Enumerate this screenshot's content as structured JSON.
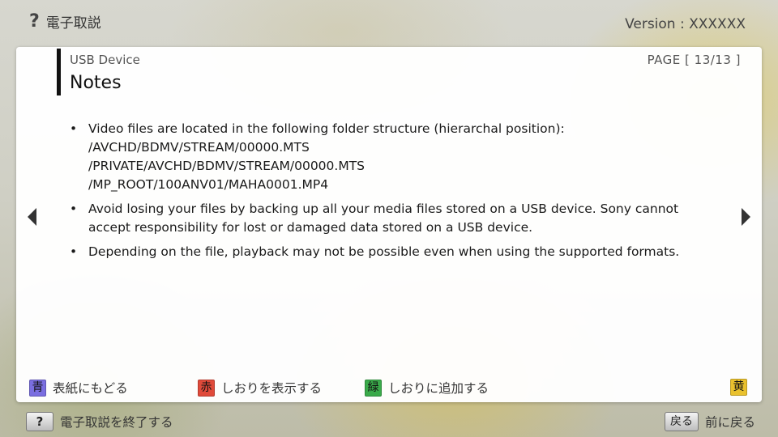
{
  "top": {
    "help_mark": "?",
    "title": "電子取説",
    "version": "Version : XXXXXX"
  },
  "panel": {
    "category": "USB Device",
    "page": "PAGE [ 13/13 ]",
    "heading": "Notes",
    "bullet": "•",
    "items": [
      {
        "lines": [
          "Video files are located in the following folder structure (hierarchal position):",
          "/AVCHD/BDMV/STREAM/00000.MTS",
          "/PRIVATE/AVCHD/BDMV/STREAM/00000.MTS",
          "/MP_ROOT/100ANV01/MAHA0001.MP4"
        ]
      },
      {
        "lines": [
          "Avoid losing your files by backing up all your media files stored on a USB device. Sony cannot",
          "accept responsibility for lost or damaged data stored on a USB device."
        ]
      },
      {
        "lines": [
          "Depending on the file, playback may not be possible even when using the supported formats."
        ]
      }
    ]
  },
  "legend": {
    "blue": {
      "key": "青",
      "label": "表紙にもどる",
      "color": "#7a6ee0"
    },
    "red": {
      "key": "赤",
      "label": "しおりを表示する",
      "color": "#e04a3a"
    },
    "green": {
      "key": "緑",
      "label": "しおりに追加する",
      "color": "#3aaa4a"
    },
    "yellow": {
      "key": "黄",
      "color": "#e9c12e"
    }
  },
  "bottom": {
    "help_key": "?",
    "help_label": "電子取説を終了する",
    "back_key": "戻る",
    "back_label": "前に戻る"
  }
}
